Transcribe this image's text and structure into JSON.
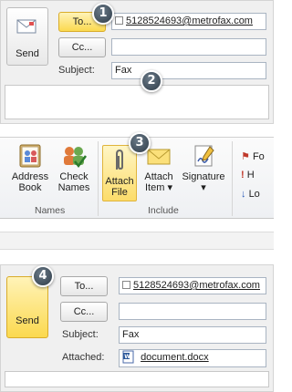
{
  "compose_top": {
    "send_label": "Send",
    "to_label": "To...",
    "cc_label": "Cc...",
    "subject_label": "Subject:",
    "to_value": "5128524693@metrofax.com",
    "cc_value": "",
    "subject_value": "Fax"
  },
  "ribbon": {
    "address_book": "Address\nBook",
    "check_names": "Check\nNames",
    "names_group": "Names",
    "attach_file": "Attach\nFile",
    "attach_item": "Attach\nItem",
    "signature": "Signature",
    "include_group": "Include",
    "side_items": [
      "Fo",
      "H",
      "Lo"
    ]
  },
  "compose_bottom": {
    "send_label": "Send",
    "to_label": "To...",
    "cc_label": "Cc...",
    "subject_label": "Subject:",
    "attached_label": "Attached:",
    "to_value": "5128524693@metrofax.com",
    "subject_value": "Fax",
    "attachment_name": "document.docx"
  },
  "badges": [
    "1",
    "2",
    "3",
    "4"
  ],
  "colors": {
    "active_yellow": "#fbd94f",
    "badge": "#3a4856"
  }
}
